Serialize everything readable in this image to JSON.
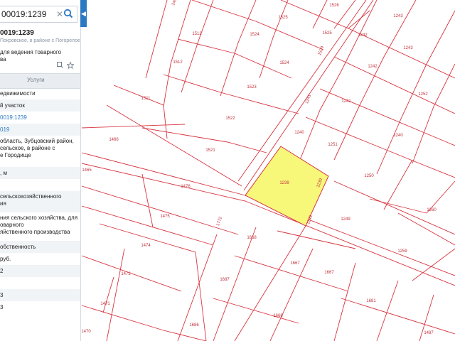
{
  "search": {
    "value": "00019:1239"
  },
  "object": {
    "title": "0019:1239",
    "subtitle": "Покровское, в районе с Погорелое",
    "purpose": "для ведения товарного\nва"
  },
  "tabs": {
    "services": "Услуги"
  },
  "info_rows": [
    "едвижимости",
    "й участок",
    "0019:1239",
    "019",
    "область, Зубцовский район,\nсельское, в районе с\nе Городище",
    ", м",
    "",
    "сельскохозяйственного\nия",
    "ния сельского хозяйства, для\nоварного\nяйственного производства",
    "обственность",
    "руб.",
    "2",
    "",
    "3",
    "3"
  ],
  "map": {
    "parcel_labels": [
      "1526",
      "1243",
      "1525",
      "1512",
      "1524",
      "1525",
      "1242",
      "1243",
      "1512",
      "1529",
      "1524",
      "1242",
      "1523",
      "1252",
      "1511",
      "1241",
      "1241",
      "1522",
      "1466",
      "1240",
      "1251",
      "1521",
      "1240",
      "1465",
      "1239",
      "1250",
      "1476",
      "1239",
      "1772",
      "1475",
      "1249",
      "1249",
      "1260",
      "1668",
      "1474",
      "1667",
      "1667",
      "1472",
      "1687",
      "1259",
      "1471",
      "1666",
      "1681",
      "1686",
      "1470",
      "1487"
    ],
    "selected_parcel": "1239",
    "highlight_color": "#f7f77a",
    "line_color": "#d8343f"
  }
}
